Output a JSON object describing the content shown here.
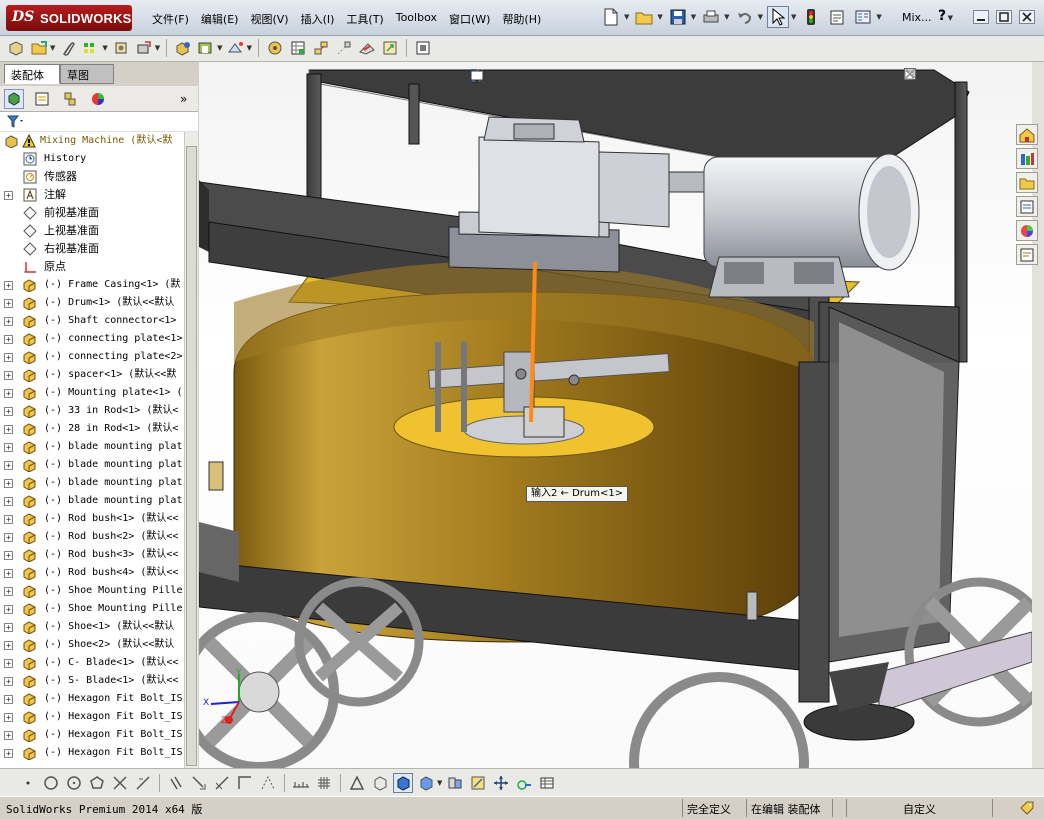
{
  "app": {
    "logo_ds": "DS",
    "logo_text": "SOLIDWORKS",
    "window_title_short": "Mix...",
    "help_label": "?"
  },
  "menu": [
    "文件(F)",
    "编辑(E)",
    "视图(V)",
    "插入(I)",
    "工具(T)",
    "Toolbox",
    "窗口(W)",
    "帮助(H)"
  ],
  "tabs": {
    "assembly": "装配体",
    "sketch": "草图"
  },
  "tree": {
    "root": "Mixing Machine  (默认<默",
    "items": [
      {
        "pm": "",
        "icon": "history-icon",
        "label": "History"
      },
      {
        "pm": "",
        "icon": "sensor-icon",
        "label": "传感器"
      },
      {
        "pm": "+",
        "icon": "annotation-icon",
        "label": "注解"
      },
      {
        "pm": "",
        "icon": "plane-icon",
        "label": "前视基准面"
      },
      {
        "pm": "",
        "icon": "plane-icon",
        "label": "上视基准面"
      },
      {
        "pm": "",
        "icon": "plane-icon",
        "label": "右视基准面"
      },
      {
        "pm": "",
        "icon": "origin-icon",
        "label": "原点"
      },
      {
        "pm": "+",
        "icon": "part-icon",
        "label": "(-) Frame Casing<1> (默"
      },
      {
        "pm": "+",
        "icon": "part-icon",
        "label": "(-) Drum<1> (默认<<默认"
      },
      {
        "pm": "+",
        "icon": "part-icon",
        "label": "(-) Shaft connector<1>"
      },
      {
        "pm": "+",
        "icon": "part-icon",
        "label": "(-) connecting plate<1>"
      },
      {
        "pm": "+",
        "icon": "part-icon",
        "label": "(-) connecting plate<2>"
      },
      {
        "pm": "+",
        "icon": "part-icon",
        "label": "(-) spacer<1> (默认<<默"
      },
      {
        "pm": "+",
        "icon": "part-icon",
        "label": "(-) Mounting plate<1> ("
      },
      {
        "pm": "+",
        "icon": "part-icon",
        "label": "(-) 33 in Rod<1> (默认<"
      },
      {
        "pm": "+",
        "icon": "part-icon",
        "label": "(-) 28 in Rod<1> (默认<"
      },
      {
        "pm": "+",
        "icon": "part-icon",
        "label": "(-) blade mounting plat"
      },
      {
        "pm": "+",
        "icon": "part-icon",
        "label": "(-) blade mounting plat"
      },
      {
        "pm": "+",
        "icon": "part-icon",
        "label": "(-) blade mounting plat"
      },
      {
        "pm": "+",
        "icon": "part-icon",
        "label": "(-) blade mounting plat"
      },
      {
        "pm": "+",
        "icon": "part-icon",
        "label": "(-) Rod bush<1> (默认<<"
      },
      {
        "pm": "+",
        "icon": "part-icon",
        "label": "(-) Rod bush<2> (默认<<"
      },
      {
        "pm": "+",
        "icon": "part-icon",
        "label": "(-) Rod bush<3> (默认<<"
      },
      {
        "pm": "+",
        "icon": "part-icon",
        "label": "(-) Rod bush<4> (默认<<"
      },
      {
        "pm": "+",
        "icon": "part-icon",
        "label": "(-) Shoe Mounting Pille"
      },
      {
        "pm": "+",
        "icon": "part-icon",
        "label": "(-) Shoe Mounting Pille"
      },
      {
        "pm": "+",
        "icon": "part-icon",
        "label": "(-) Shoe<1> (默认<<默认"
      },
      {
        "pm": "+",
        "icon": "part-icon",
        "label": "(-) Shoe<2> (默认<<默认"
      },
      {
        "pm": "+",
        "icon": "part-icon",
        "label": "(-) C- Blade<1> (默认<<"
      },
      {
        "pm": "+",
        "icon": "part-icon",
        "label": "(-) S- Blade<1> (默认<<"
      },
      {
        "pm": "+",
        "icon": "part-icon",
        "label": "(-) Hexagon Fit Bolt_IS"
      },
      {
        "pm": "+",
        "icon": "part-icon",
        "label": "(-) Hexagon Fit Bolt_IS"
      },
      {
        "pm": "+",
        "icon": "part-icon",
        "label": "(-) Hexagon Fit Bolt_IS"
      },
      {
        "pm": "+",
        "icon": "part-icon",
        "label": "(-) Hexagon Fit Bolt_IS"
      }
    ]
  },
  "viewport": {
    "tooltip": "输入2 ← Drum<1>",
    "triad_x": "X",
    "triad_y": "Y",
    "triad_z": "Z"
  },
  "status": {
    "app": "SolidWorks Premium 2014 x64 版",
    "defined": "完全定义",
    "editing": "在编辑 装配体",
    "custom": "自定义"
  },
  "colors": {
    "accent_red": "#b71c1c",
    "drum_gold": "#c9a23a",
    "frame_dark": "#4a4a4a",
    "motor_gray": "#c9ccd2",
    "selection_orange": "#ff8a1a"
  }
}
